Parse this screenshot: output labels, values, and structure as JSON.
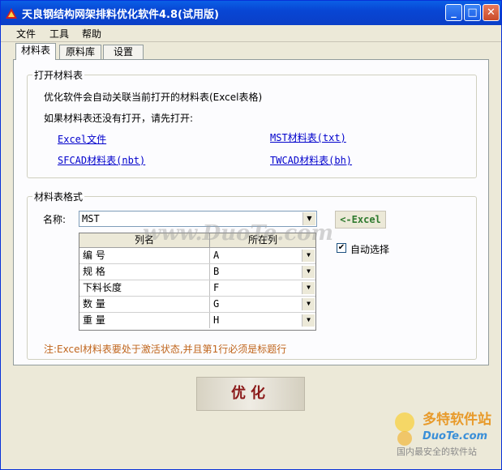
{
  "window": {
    "title": "天良钢结构网架排料优化软件4.8(试用版)",
    "minimize": "_",
    "maximize": "□",
    "close": "✕"
  },
  "menu": [
    "文件",
    "工具",
    "帮助"
  ],
  "tabs": [
    "材料表",
    "原料库",
    "设置"
  ],
  "open_group": {
    "title": "打开材料表",
    "line1": "优化软件会自动关联当前打开的材料表(Excel表格)",
    "line2": "如果材料表还没有打开，请先打开:",
    "links": [
      "Excel文件",
      "MST材料表(txt)",
      "SFCAD材料表(nbt)",
      "TWCAD材料表(bh)"
    ]
  },
  "format_group": {
    "title": "材料表格式",
    "name_label": "名称:",
    "name_value": "MST",
    "excel_button": "<-Excel",
    "auto_select_label": "自动选择",
    "auto_select_checked": "✔",
    "columns": [
      "列名",
      "所在列"
    ],
    "rows": [
      {
        "name": "编  号",
        "col": "A"
      },
      {
        "name": "规  格",
        "col": "B"
      },
      {
        "name": "下料长度",
        "col": "F"
      },
      {
        "name": "数  量",
        "col": "G"
      },
      {
        "name": "重  量",
        "col": "H"
      }
    ],
    "note": "注:Excel材料表要处于激活状态,并且第1行必须是标题行"
  },
  "optimize_button": "优化",
  "watermark": "www.DuoTe.com",
  "logo": {
    "main": "多特软件站",
    "url": "DuoTe.com",
    "slogan": "国内最安全的软件站"
  },
  "dropdown_arrow": "▼",
  "colors": {
    "title_bar": "#0a5fe6",
    "note": "#c0651c",
    "link": "#0000cc",
    "excel_button": "#2f7a2f",
    "optimize_text": "#8b1a1a"
  }
}
